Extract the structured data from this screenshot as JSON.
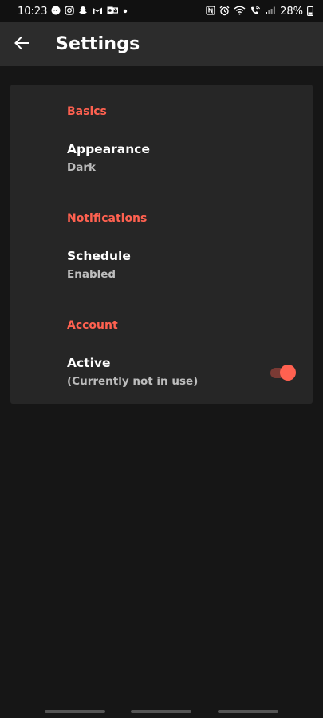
{
  "status_bar": {
    "time": "10:23",
    "battery": "28%",
    "left_icons": [
      "messenger-icon",
      "instagram-icon",
      "snapchat-icon",
      "gmail-icon",
      "outlook-icon",
      "dot-icon"
    ],
    "right_icons": [
      "nfc-icon",
      "alarm-icon",
      "wifi-icon",
      "wifi-call-icon",
      "signal-icon",
      "battery-icon"
    ]
  },
  "app_bar": {
    "title": "Settings",
    "back_icon": "arrow-left-icon"
  },
  "sections": [
    {
      "header": "Basics",
      "item": {
        "title": "Appearance",
        "subtitle": "Dark"
      }
    },
    {
      "header": "Notifications",
      "item": {
        "title": "Schedule",
        "subtitle": "Enabled"
      }
    },
    {
      "header": "Account",
      "item": {
        "title": "Active",
        "subtitle": "(Currently not in use)"
      },
      "toggle_on": true
    }
  ],
  "colors": {
    "accent": "#ff6150",
    "card": "#262626",
    "background": "#161616",
    "app_bar": "#2c2c2c"
  }
}
